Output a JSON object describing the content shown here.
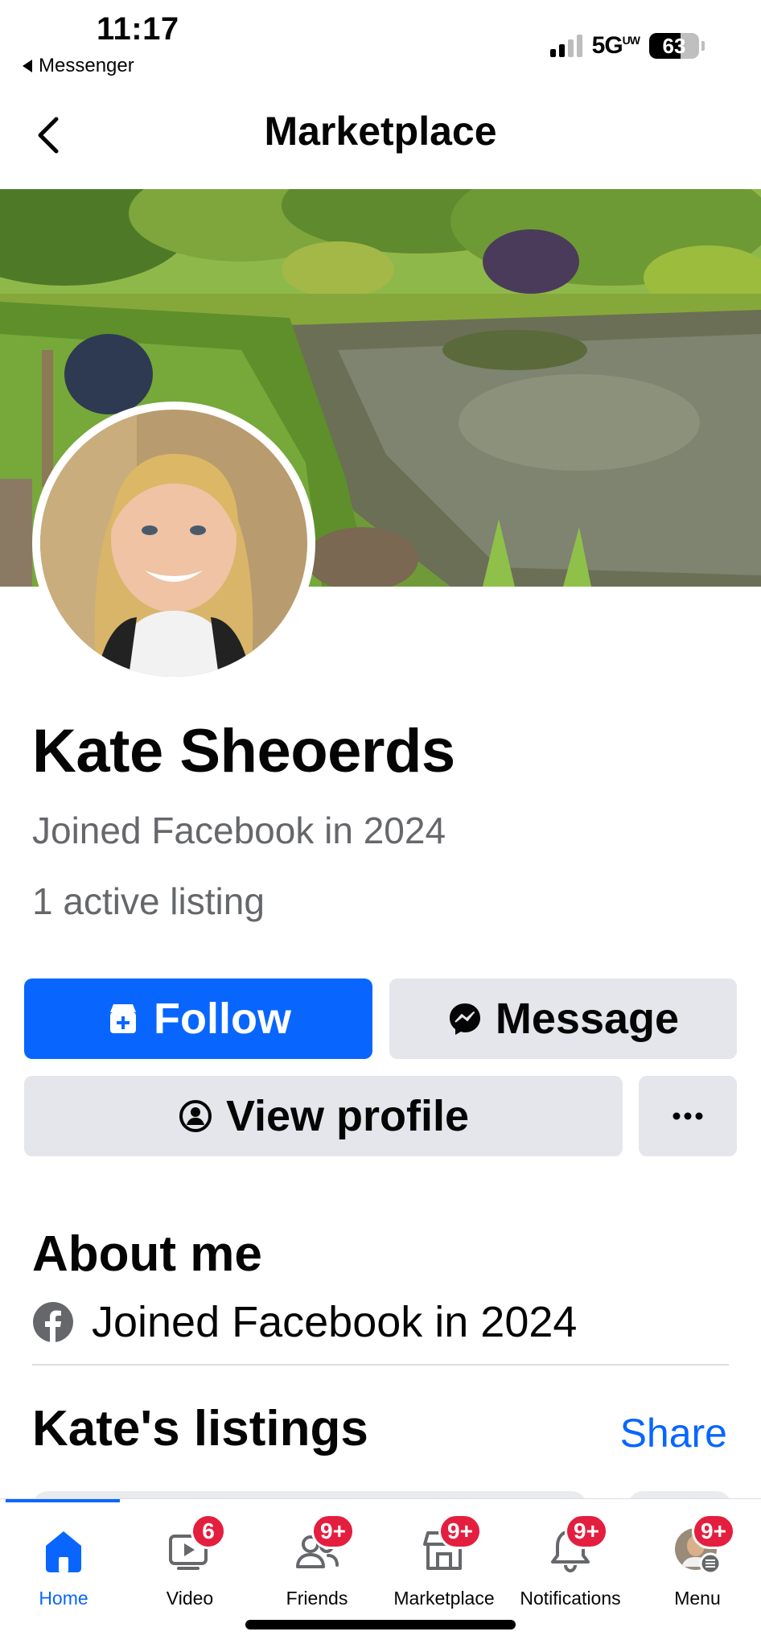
{
  "status_bar": {
    "time": "11:17",
    "back_app": "Messenger",
    "network": "5G",
    "network_sup": "UW",
    "battery": "63",
    "battery_level": 0.63
  },
  "header": {
    "title": "Marketplace"
  },
  "profile": {
    "name": "Kate Sheoerds",
    "joined": "Joined Facebook in 2024",
    "active_listings": "1 active listing"
  },
  "actions": {
    "follow_label": "Follow",
    "message_label": "Message",
    "view_profile_label": "View profile"
  },
  "about": {
    "title": "About me",
    "joined": "Joined Facebook in 2024"
  },
  "listings": {
    "title": "Kate's listings",
    "share_label": "Share"
  },
  "bottom_nav": [
    {
      "label": "Home",
      "icon": "home-icon",
      "badge": "",
      "active": true
    },
    {
      "label": "Video",
      "icon": "video-icon",
      "badge": "6",
      "active": false
    },
    {
      "label": "Friends",
      "icon": "friends-icon",
      "badge": "9+",
      "active": false
    },
    {
      "label": "Marketplace",
      "icon": "marketplace-icon",
      "badge": "9+",
      "active": false
    },
    {
      "label": "Notifications",
      "icon": "bell-icon",
      "badge": "9+",
      "active": false
    },
    {
      "label": "Menu",
      "icon": "avatar-menu-icon",
      "badge": "9+",
      "active": false
    }
  ],
  "colors": {
    "accent": "#0866ff",
    "badge": "#e41e3f",
    "secondary_button": "#e4e6eb",
    "muted_text": "#65676b"
  }
}
